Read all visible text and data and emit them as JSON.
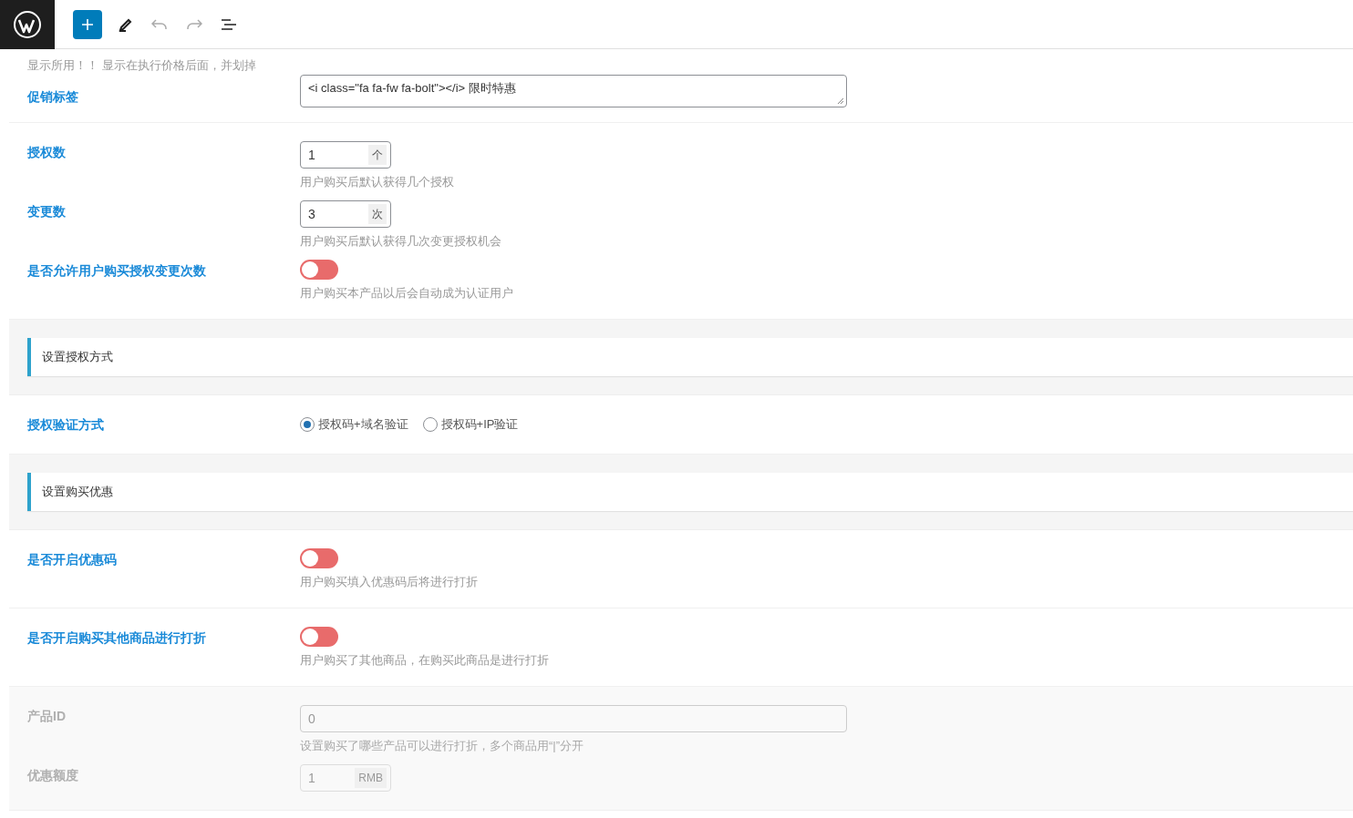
{
  "groups": [
    {
      "kind": "fields",
      "disabled": false,
      "fields": [
        {
          "kind": "note",
          "text": "显示所用！！ 显示在执行价格后面，并划掉"
        },
        {
          "kind": "textarea",
          "label": "促销标签",
          "value": "<i class=\"fa fa-fw fa-bolt\"></i> 限时特惠"
        }
      ]
    },
    {
      "kind": "fields",
      "disabled": false,
      "fields": [
        {
          "kind": "number",
          "label": "授权数",
          "value": "1",
          "unit": "个",
          "help": "用户购买后默认获得几个授权"
        },
        {
          "kind": "number",
          "label": "变更数",
          "value": "3",
          "unit": "次",
          "help": "用户购买后默认获得几次变更授权机会"
        },
        {
          "kind": "switch",
          "label": "是否允许用户购买授权变更次数",
          "on": false,
          "help": "用户购买本产品以后会自动成为认证用户"
        }
      ]
    },
    {
      "kind": "section",
      "title": "设置授权方式"
    },
    {
      "kind": "fields",
      "disabled": false,
      "fields": [
        {
          "kind": "radio",
          "label": "授权验证方式",
          "options": [
            {
              "label": "授权码+域名验证",
              "selected": true
            },
            {
              "label": "授权码+IP验证",
              "selected": false
            }
          ]
        }
      ]
    },
    {
      "kind": "section",
      "title": "设置购买优惠"
    },
    {
      "kind": "fields",
      "disabled": false,
      "fields": [
        {
          "kind": "switch",
          "label": "是否开启优惠码",
          "on": false,
          "help": "用户购买填入优惠码后将进行打折"
        }
      ]
    },
    {
      "kind": "fields",
      "disabled": false,
      "fields": [
        {
          "kind": "switch",
          "label": "是否开启购买其他商品进行打折",
          "on": false,
          "help": "用户购买了其他商品，在购买此商品是进行打折"
        }
      ]
    },
    {
      "kind": "fields",
      "disabled": true,
      "fields": [
        {
          "kind": "text",
          "label": "产品ID",
          "value": "0",
          "help": "设置购买了哪些产品可以进行打折，多个商品用“|”分开"
        },
        {
          "kind": "number",
          "label": "优惠额度",
          "value": "1",
          "unit": "RMB"
        }
      ]
    }
  ]
}
